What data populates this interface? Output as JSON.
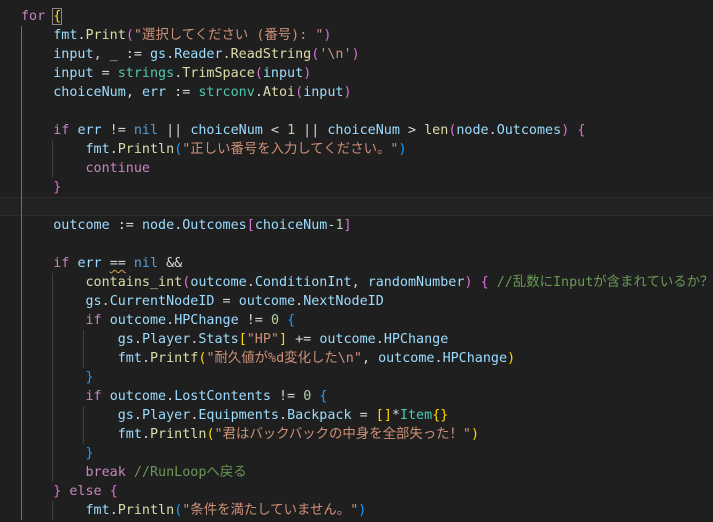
{
  "editor": {
    "theme_background": "#1f1f1f",
    "colors": {
      "keyword": "#c586c0",
      "variable": "#9cdcfe",
      "function": "#dcdcaa",
      "type": "#4ec9b0",
      "string": "#ce9178",
      "number": "#b5cea8",
      "comment": "#6a9955",
      "bracket_gold": "#ffd700",
      "bracket_orchid": "#da70d6",
      "bracket_blue": "#179fff"
    },
    "lines": [
      {
        "tokens": [
          {
            "t": "for",
            "c": "kw"
          },
          {
            "t": " ",
            "c": "op"
          },
          {
            "t": "{",
            "c": "br1 bm"
          }
        ]
      },
      {
        "tokens": [
          {
            "t": "    ",
            "c": "op"
          },
          {
            "t": "fmt",
            "c": "var"
          },
          {
            "t": ".",
            "c": "op"
          },
          {
            "t": "Print",
            "c": "fn"
          },
          {
            "t": "(",
            "c": "br2"
          },
          {
            "t": "\"選択してください (番号): \"",
            "c": "str"
          },
          {
            "t": ")",
            "c": "br2"
          }
        ]
      },
      {
        "tokens": [
          {
            "t": "    ",
            "c": "op"
          },
          {
            "t": "input",
            "c": "var"
          },
          {
            "t": ", ",
            "c": "op"
          },
          {
            "t": "_",
            "c": "var"
          },
          {
            "t": " := ",
            "c": "op"
          },
          {
            "t": "gs",
            "c": "var"
          },
          {
            "t": ".",
            "c": "op"
          },
          {
            "t": "Reader",
            "c": "var"
          },
          {
            "t": ".",
            "c": "op"
          },
          {
            "t": "ReadString",
            "c": "fn"
          },
          {
            "t": "(",
            "c": "br2"
          },
          {
            "t": "'\\n'",
            "c": "str"
          },
          {
            "t": ")",
            "c": "br2"
          }
        ]
      },
      {
        "tokens": [
          {
            "t": "    ",
            "c": "op"
          },
          {
            "t": "input",
            "c": "var"
          },
          {
            "t": " = ",
            "c": "op"
          },
          {
            "t": "strings",
            "c": "ty"
          },
          {
            "t": ".",
            "c": "op"
          },
          {
            "t": "TrimSpace",
            "c": "fn"
          },
          {
            "t": "(",
            "c": "br2"
          },
          {
            "t": "input",
            "c": "var"
          },
          {
            "t": ")",
            "c": "br2"
          }
        ]
      },
      {
        "tokens": [
          {
            "t": "    ",
            "c": "op"
          },
          {
            "t": "choiceNum",
            "c": "var"
          },
          {
            "t": ", ",
            "c": "op"
          },
          {
            "t": "err",
            "c": "var"
          },
          {
            "t": " := ",
            "c": "op"
          },
          {
            "t": "strconv",
            "c": "ty"
          },
          {
            "t": ".",
            "c": "op"
          },
          {
            "t": "Atoi",
            "c": "fn"
          },
          {
            "t": "(",
            "c": "br2"
          },
          {
            "t": "input",
            "c": "var"
          },
          {
            "t": ")",
            "c": "br2"
          }
        ]
      },
      {
        "tokens": []
      },
      {
        "tokens": [
          {
            "t": "    ",
            "c": "op"
          },
          {
            "t": "if",
            "c": "kw"
          },
          {
            "t": " ",
            "c": "op"
          },
          {
            "t": "err",
            "c": "var"
          },
          {
            "t": " != ",
            "c": "op"
          },
          {
            "t": "nil",
            "c": "kw2"
          },
          {
            "t": " || ",
            "c": "op"
          },
          {
            "t": "choiceNum",
            "c": "var"
          },
          {
            "t": " < ",
            "c": "op"
          },
          {
            "t": "1",
            "c": "num"
          },
          {
            "t": " || ",
            "c": "op"
          },
          {
            "t": "choiceNum",
            "c": "var"
          },
          {
            "t": " > ",
            "c": "op"
          },
          {
            "t": "len",
            "c": "fn"
          },
          {
            "t": "(",
            "c": "br2"
          },
          {
            "t": "node",
            "c": "var"
          },
          {
            "t": ".",
            "c": "op"
          },
          {
            "t": "Outcomes",
            "c": "var"
          },
          {
            "t": ")",
            "c": "br2"
          },
          {
            "t": " ",
            "c": "op"
          },
          {
            "t": "{",
            "c": "br2"
          }
        ]
      },
      {
        "tokens": [
          {
            "t": "        ",
            "c": "op"
          },
          {
            "t": "fmt",
            "c": "var"
          },
          {
            "t": ".",
            "c": "op"
          },
          {
            "t": "Println",
            "c": "fn"
          },
          {
            "t": "(",
            "c": "br3"
          },
          {
            "t": "\"正しい番号を入力してください。\"",
            "c": "str"
          },
          {
            "t": ")",
            "c": "br3"
          }
        ]
      },
      {
        "tokens": [
          {
            "t": "        ",
            "c": "op"
          },
          {
            "t": "continue",
            "c": "kw"
          }
        ]
      },
      {
        "tokens": [
          {
            "t": "    ",
            "c": "op"
          },
          {
            "t": "}",
            "c": "br2"
          }
        ]
      },
      {
        "tokens": [],
        "current": true
      },
      {
        "tokens": [
          {
            "t": "    ",
            "c": "op"
          },
          {
            "t": "outcome",
            "c": "var"
          },
          {
            "t": " := ",
            "c": "op"
          },
          {
            "t": "node",
            "c": "var"
          },
          {
            "t": ".",
            "c": "op"
          },
          {
            "t": "Outcomes",
            "c": "var"
          },
          {
            "t": "[",
            "c": "br2"
          },
          {
            "t": "choiceNum",
            "c": "var"
          },
          {
            "t": "-",
            "c": "op"
          },
          {
            "t": "1",
            "c": "num"
          },
          {
            "t": "]",
            "c": "br2"
          }
        ]
      },
      {
        "tokens": []
      },
      {
        "tokens": [
          {
            "t": "    ",
            "c": "op"
          },
          {
            "t": "if",
            "c": "kw"
          },
          {
            "t": " ",
            "c": "op"
          },
          {
            "t": "err",
            "c": "var"
          },
          {
            "t": " ",
            "c": "op"
          },
          {
            "t": "==",
            "c": "op squig"
          },
          {
            "t": " ",
            "c": "op"
          },
          {
            "t": "nil",
            "c": "kw2"
          },
          {
            "t": " &&",
            "c": "op"
          }
        ]
      },
      {
        "tokens": [
          {
            "t": "        ",
            "c": "op"
          },
          {
            "t": "contains_int",
            "c": "fn"
          },
          {
            "t": "(",
            "c": "br2"
          },
          {
            "t": "outcome",
            "c": "var"
          },
          {
            "t": ".",
            "c": "op"
          },
          {
            "t": "ConditionInt",
            "c": "var"
          },
          {
            "t": ", ",
            "c": "op"
          },
          {
            "t": "randomNumber",
            "c": "var"
          },
          {
            "t": ")",
            "c": "br2"
          },
          {
            "t": " ",
            "c": "op"
          },
          {
            "t": "{",
            "c": "br2"
          },
          {
            "t": " ",
            "c": "op"
          },
          {
            "t": "//乱数にInputが含まれているか？",
            "c": "cmt"
          }
        ]
      },
      {
        "tokens": [
          {
            "t": "        ",
            "c": "op"
          },
          {
            "t": "gs",
            "c": "var"
          },
          {
            "t": ".",
            "c": "op"
          },
          {
            "t": "CurrentNodeID",
            "c": "var"
          },
          {
            "t": " = ",
            "c": "op"
          },
          {
            "t": "outcome",
            "c": "var"
          },
          {
            "t": ".",
            "c": "op"
          },
          {
            "t": "NextNodeID",
            "c": "var"
          }
        ]
      },
      {
        "tokens": [
          {
            "t": "        ",
            "c": "op"
          },
          {
            "t": "if",
            "c": "kw"
          },
          {
            "t": " ",
            "c": "op"
          },
          {
            "t": "outcome",
            "c": "var"
          },
          {
            "t": ".",
            "c": "op"
          },
          {
            "t": "HPChange",
            "c": "var"
          },
          {
            "t": " != ",
            "c": "op"
          },
          {
            "t": "0",
            "c": "num"
          },
          {
            "t": " ",
            "c": "op"
          },
          {
            "t": "{",
            "c": "br3"
          }
        ]
      },
      {
        "tokens": [
          {
            "t": "            ",
            "c": "op"
          },
          {
            "t": "gs",
            "c": "var"
          },
          {
            "t": ".",
            "c": "op"
          },
          {
            "t": "Player",
            "c": "var"
          },
          {
            "t": ".",
            "c": "op"
          },
          {
            "t": "Stats",
            "c": "var"
          },
          {
            "t": "[",
            "c": "br1"
          },
          {
            "t": "\"HP\"",
            "c": "str"
          },
          {
            "t": "]",
            "c": "br1"
          },
          {
            "t": " += ",
            "c": "op"
          },
          {
            "t": "outcome",
            "c": "var"
          },
          {
            "t": ".",
            "c": "op"
          },
          {
            "t": "HPChange",
            "c": "var"
          }
        ]
      },
      {
        "tokens": [
          {
            "t": "            ",
            "c": "op"
          },
          {
            "t": "fmt",
            "c": "var"
          },
          {
            "t": ".",
            "c": "op"
          },
          {
            "t": "Printf",
            "c": "fn"
          },
          {
            "t": "(",
            "c": "br1"
          },
          {
            "t": "\"耐久値が%d変化した\\n\"",
            "c": "str"
          },
          {
            "t": ", ",
            "c": "op"
          },
          {
            "t": "outcome",
            "c": "var"
          },
          {
            "t": ".",
            "c": "op"
          },
          {
            "t": "HPChange",
            "c": "var"
          },
          {
            "t": ")",
            "c": "br1"
          }
        ]
      },
      {
        "tokens": [
          {
            "t": "        ",
            "c": "op"
          },
          {
            "t": "}",
            "c": "br3"
          }
        ]
      },
      {
        "tokens": [
          {
            "t": "        ",
            "c": "op"
          },
          {
            "t": "if",
            "c": "kw"
          },
          {
            "t": " ",
            "c": "op"
          },
          {
            "t": "outcome",
            "c": "var"
          },
          {
            "t": ".",
            "c": "op"
          },
          {
            "t": "LostContents",
            "c": "var"
          },
          {
            "t": " != ",
            "c": "op"
          },
          {
            "t": "0",
            "c": "num"
          },
          {
            "t": " ",
            "c": "op"
          },
          {
            "t": "{",
            "c": "br3"
          }
        ]
      },
      {
        "tokens": [
          {
            "t": "            ",
            "c": "op"
          },
          {
            "t": "gs",
            "c": "var"
          },
          {
            "t": ".",
            "c": "op"
          },
          {
            "t": "Player",
            "c": "var"
          },
          {
            "t": ".",
            "c": "op"
          },
          {
            "t": "Equipments",
            "c": "var"
          },
          {
            "t": ".",
            "c": "op"
          },
          {
            "t": "Backpack",
            "c": "var"
          },
          {
            "t": " = ",
            "c": "op"
          },
          {
            "t": "[",
            "c": "br1"
          },
          {
            "t": "]",
            "c": "br1"
          },
          {
            "t": "*",
            "c": "op"
          },
          {
            "t": "Item",
            "c": "ty"
          },
          {
            "t": "{",
            "c": "br1"
          },
          {
            "t": "}",
            "c": "br1"
          }
        ]
      },
      {
        "tokens": [
          {
            "t": "            ",
            "c": "op"
          },
          {
            "t": "fmt",
            "c": "var"
          },
          {
            "t": ".",
            "c": "op"
          },
          {
            "t": "Println",
            "c": "fn"
          },
          {
            "t": "(",
            "c": "br1"
          },
          {
            "t": "\"君はバックバックの中身を全部失った！\"",
            "c": "str"
          },
          {
            "t": ")",
            "c": "br1"
          }
        ]
      },
      {
        "tokens": [
          {
            "t": "        ",
            "c": "op"
          },
          {
            "t": "}",
            "c": "br3"
          }
        ]
      },
      {
        "tokens": [
          {
            "t": "        ",
            "c": "op"
          },
          {
            "t": "break",
            "c": "kw"
          },
          {
            "t": " ",
            "c": "op"
          },
          {
            "t": "//RunLoopへ戻る",
            "c": "cmt"
          }
        ]
      },
      {
        "tokens": [
          {
            "t": "    ",
            "c": "op"
          },
          {
            "t": "}",
            "c": "br2"
          },
          {
            "t": " ",
            "c": "op"
          },
          {
            "t": "else",
            "c": "kw"
          },
          {
            "t": " ",
            "c": "op"
          },
          {
            "t": "{",
            "c": "br2"
          }
        ]
      },
      {
        "tokens": [
          {
            "t": "        ",
            "c": "op"
          },
          {
            "t": "fmt",
            "c": "var"
          },
          {
            "t": ".",
            "c": "op"
          },
          {
            "t": "Println",
            "c": "fn"
          },
          {
            "t": "(",
            "c": "br3"
          },
          {
            "t": "\"条件を満たしていません。\"",
            "c": "str"
          },
          {
            "t": ")",
            "c": "br3"
          }
        ]
      }
    ]
  }
}
